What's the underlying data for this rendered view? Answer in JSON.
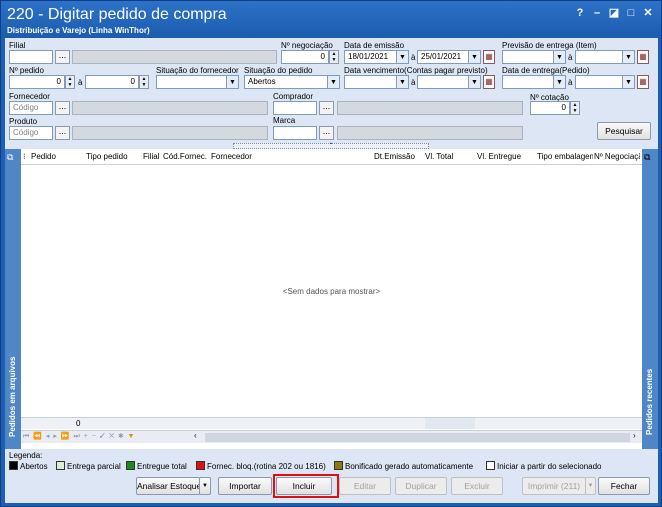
{
  "window": {
    "title": "220 - Digitar pedido de compra",
    "subtitle": "Distribuição e Varejo (Linha WinThor)",
    "help": "?",
    "minimize": "–",
    "maximize": "□",
    "close": "✕"
  },
  "filters": {
    "filial": {
      "label": "Filial"
    },
    "num_negociacao": {
      "label": "Nº negociação",
      "value": "0"
    },
    "data_emissao": {
      "label": "Data de emissão",
      "from": "18/01/2021",
      "to_sep": "à",
      "to": "25/01/2021"
    },
    "previsao_entrega": {
      "label": "Previsão  de entrega (Item)",
      "to_sep": "à"
    },
    "num_pedido": {
      "label": "Nº pedido",
      "from": "0",
      "to_sep": "à",
      "to": "0"
    },
    "situacao_fornecedor": {
      "label": "Situação do fornecedor"
    },
    "situacao_pedido": {
      "label": "Situação do pedido",
      "value": "Abertos"
    },
    "data_vencimento": {
      "label": "Data vencimento(Contas pagar previsto)",
      "to_sep": "à"
    },
    "data_entrega_pedido": {
      "label": "Data de entrega(Pedido)",
      "to_sep": "à"
    },
    "fornecedor": {
      "label": "Fornecedor",
      "placeholder": "Código"
    },
    "comprador": {
      "label": "Comprador"
    },
    "num_cotacao": {
      "label": "Nº cotação",
      "value": "0"
    },
    "produto": {
      "label": "Produto",
      "placeholder": "Código"
    },
    "marca": {
      "label": "Marca"
    },
    "pesquisar": "Pesquisar"
  },
  "grid": {
    "columns": [
      "Pedido",
      "Tipo pedido",
      "Filial",
      "Cód.Fornec.",
      "Fornecedor",
      "Dt.Emissão",
      "Vl. Total",
      "Vl. Entregue",
      "Tipo embalagem",
      "Nº Negociação"
    ],
    "empty_text": "<Sem dados para mostrar>",
    "footer_count": "0",
    "left_sidebar": "Pedidos em arquivos",
    "right_sidebar": "Pedidos recentes"
  },
  "legend": {
    "title": "Legenda:",
    "items": [
      {
        "label": "Abertos",
        "color": "#000000"
      },
      {
        "label": "Entrega parcial",
        "color": "#d8f0d0"
      },
      {
        "label": "Entregue total",
        "color": "#1a8a1a"
      },
      {
        "label": "Fornec. bloq.(rotina 202 ou 1816)",
        "color": "#e01010"
      },
      {
        "label": "Bonificado gerado automaticamente",
        "color": "#8a7a10"
      },
      {
        "label": "Iniciar a partir do selecionado",
        "color": "#ffffff"
      }
    ]
  },
  "buttons": {
    "analisar": "Analisar Estoque",
    "importar": "Importar",
    "incluir": "Incluir",
    "editar": "Editar",
    "duplicar": "Duplicar",
    "excluir": "Excluir",
    "imprimir": "Imprimir (211)",
    "fechar": "Fechar"
  }
}
